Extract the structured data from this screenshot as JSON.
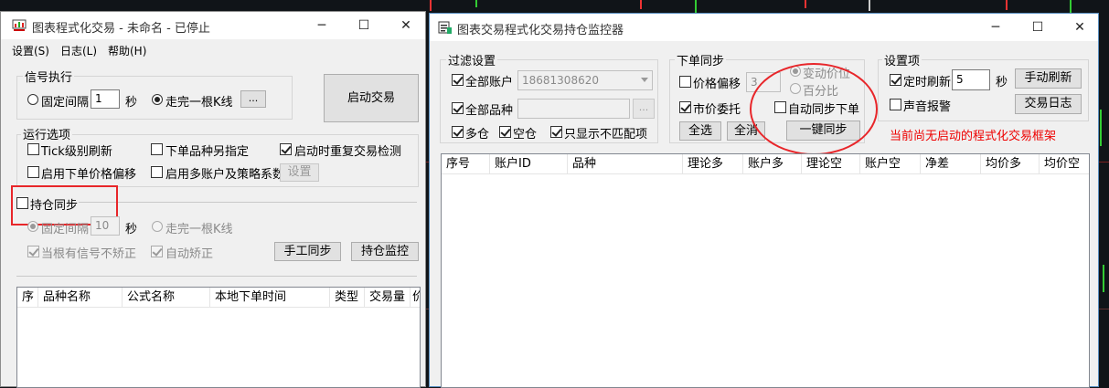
{
  "main_window": {
    "title": "图表程式化交易 - 未命名 - 已停止",
    "menu": [
      "设置(S)",
      "日志(L)",
      "帮助(H)"
    ],
    "signal_group": {
      "label": "信号执行",
      "fixed_interval_label": "固定间隔",
      "interval_value": "1",
      "seconds_unit": "秒",
      "bar_complete_label": "走完一根K线",
      "dots_button": "...",
      "start_button": "启动交易"
    },
    "run_options": {
      "label": "运行选项",
      "tick_refresh": "Tick级别刷新",
      "order_symbol_other": "下单品种另指定",
      "restart_check": "启动时重复交易检测",
      "order_price_offset": "启用下单价格偏移",
      "multi_account": "启用多账户及策略系数",
      "settings_button": "设置"
    },
    "position_sync": {
      "label": "持仓同步",
      "fixed_interval_label": "固定间隔",
      "interval_value": "10",
      "seconds_unit": "秒",
      "bar_complete_label": "走完一根K线",
      "no_correct_label": "当根有信号不矫正",
      "auto_correct_label": "自动矫正",
      "manual_sync_button": "手工同步",
      "position_monitor_button": "持仓监控"
    },
    "table_headers": [
      "序",
      "品种名称",
      "公式名称",
      "本地下单时间",
      "类型",
      "交易量",
      "价"
    ]
  },
  "monitor_window": {
    "title": "图表交易程式化交易持仓监控器",
    "filter": {
      "label": "过滤设置",
      "all_accounts_label": "全部账户",
      "account_value": "18681308620",
      "all_symbols_label": "全部品种",
      "symbol_value": "",
      "dots_button": "...",
      "long_label": "多仓",
      "short_label": "空仓",
      "mismatch_only_label": "只显示不匹配项"
    },
    "order_sync": {
      "label": "下单同步",
      "price_offset_label": "价格偏移",
      "price_offset_value": "3",
      "market_order_label": "市价委托",
      "change_price_label": "变动价位",
      "percent_label": "百分比",
      "auto_sync_label": "自动同步下单",
      "select_all_button": "全选",
      "clear_all_button": "全消",
      "one_click_sync_button": "一键同步"
    },
    "settings": {
      "label": "设置项",
      "timed_refresh_label": "定时刷新",
      "refresh_value": "5",
      "seconds_unit": "秒",
      "manual_refresh_button": "手动刷新",
      "sound_alarm_label": "声音报警",
      "trade_log_button": "交易日志"
    },
    "status_message": "当前尚无启动的程式化交易框架",
    "table_headers": [
      "序号",
      "账户ID",
      "品种",
      "理论多",
      "账户多",
      "理论空",
      "账户空",
      "净差",
      "均价多",
      "均价空"
    ]
  },
  "colors": {
    "highlight": "#e8262a",
    "status_text": "#e00000"
  }
}
